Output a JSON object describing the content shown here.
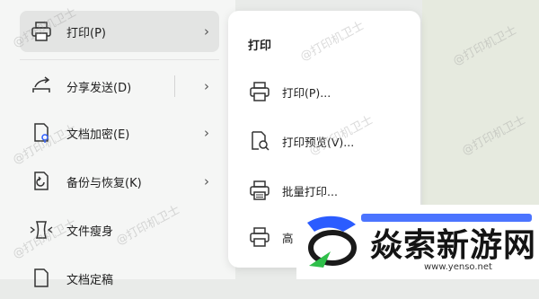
{
  "left_menu": {
    "items": [
      {
        "label": "打印(P)",
        "icon": "printer-icon",
        "active": true
      },
      {
        "label": "分享发送(D)",
        "icon": "share-icon"
      },
      {
        "label": "文档加密(E)",
        "icon": "document-lock-icon"
      },
      {
        "label": "备份与恢复(K)",
        "icon": "backup-restore-icon"
      },
      {
        "label": "文件瘦身",
        "icon": "file-slim-icon"
      },
      {
        "label": "文档定稿",
        "icon": "document-finalize-icon"
      }
    ]
  },
  "submenu": {
    "title": "打印",
    "items": [
      {
        "label": "打印(P)...",
        "icon": "printer-icon"
      },
      {
        "label": "打印预览(V)...",
        "icon": "print-preview-icon"
      },
      {
        "label": "批量打印...",
        "icon": "batch-print-icon"
      },
      {
        "label": "高",
        "icon": "printer-icon"
      }
    ]
  },
  "watermark": {
    "text": "@打印机卫士"
  },
  "logo": {
    "name": "焱索新游网",
    "url": "www.yenso.net",
    "colors": {
      "blue": "#2b5cff",
      "green": "#2fbf4a",
      "dark": "#141414"
    }
  }
}
